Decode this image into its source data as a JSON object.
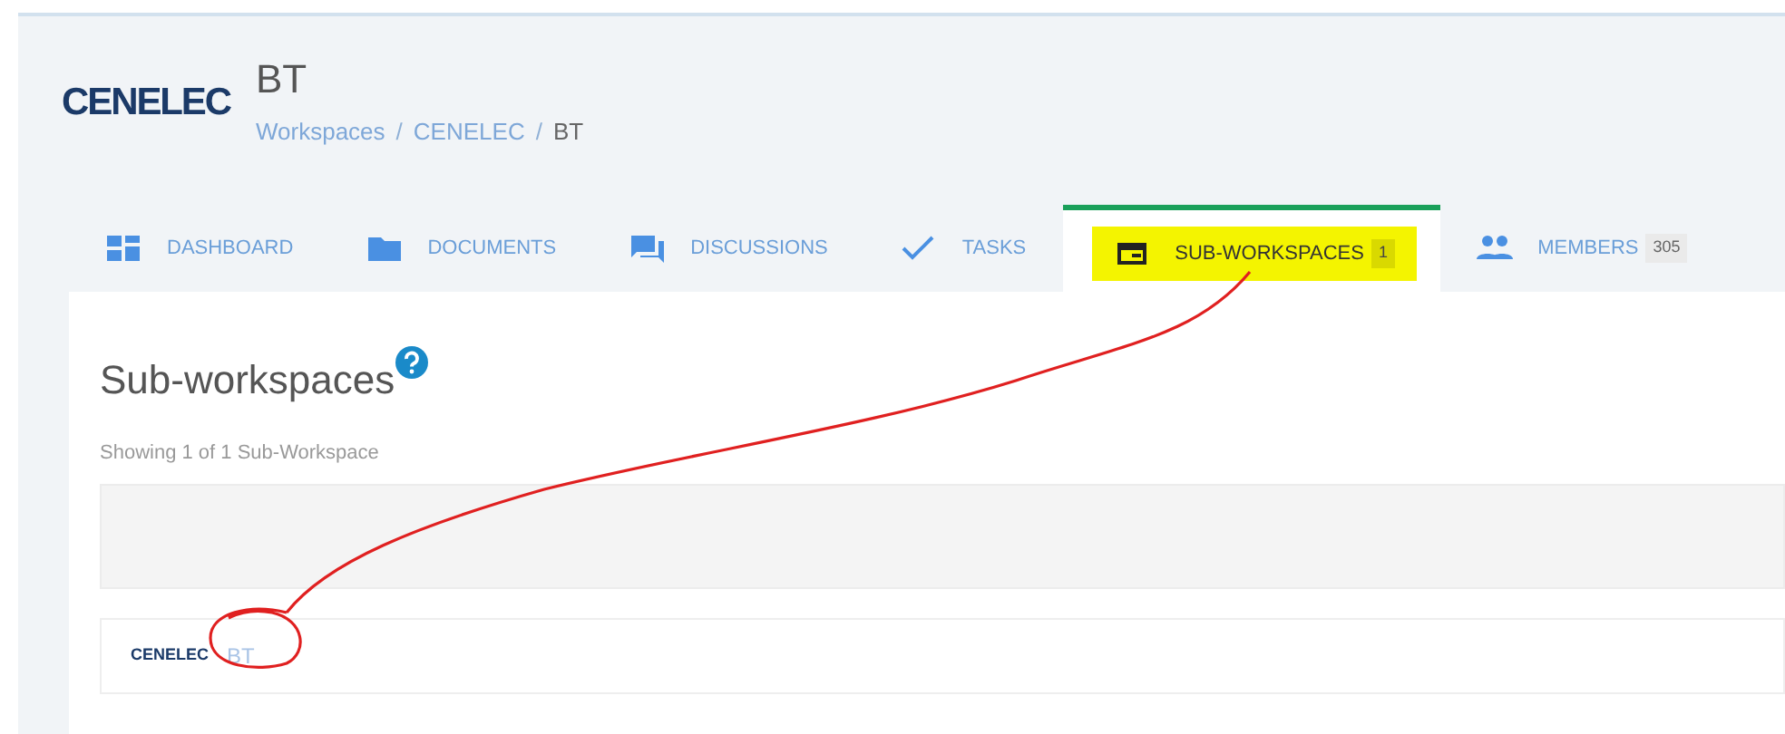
{
  "header": {
    "logo": "CENELEC",
    "title": "BT",
    "breadcrumb": [
      {
        "label": "Workspaces",
        "kind": "link"
      },
      {
        "label": "CENELEC",
        "kind": "link"
      },
      {
        "label": "BT",
        "kind": "current"
      }
    ],
    "separator": "/"
  },
  "tabs": [
    {
      "label": "DASHBOARD",
      "kind": "dashboard",
      "selected": false
    },
    {
      "label": "DOCUMENTS",
      "kind": "folder",
      "selected": false
    },
    {
      "label": "DISCUSSIONS",
      "kind": "chat",
      "selected": false
    },
    {
      "label": "TASKS",
      "kind": "check",
      "selected": false
    },
    {
      "label": "SUB-WORKSPACES",
      "kind": "window",
      "badge": "1",
      "selected": true
    },
    {
      "label": "MEMBERS",
      "kind": "people",
      "badge": "305",
      "selected": false
    }
  ],
  "content": {
    "heading": "Sub-workspaces",
    "summary": "Showing 1 of 1 Sub-Workspace",
    "items": [
      {
        "logo": "CENELEC",
        "name": "BT"
      }
    ]
  }
}
